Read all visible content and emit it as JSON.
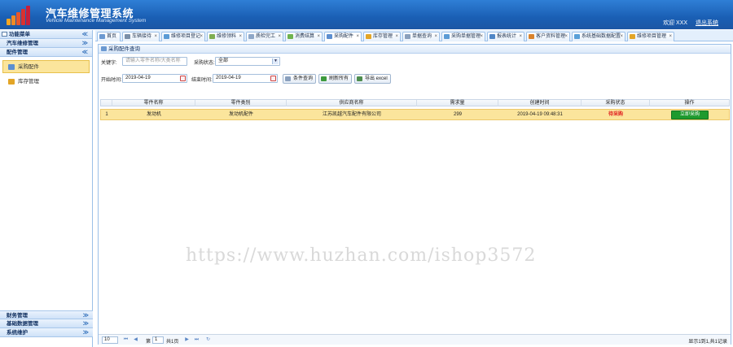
{
  "header": {
    "title": "汽车维修管理系统",
    "subtitle": "Vehicle Maintenance Management System",
    "welcome": "欢迎 XXX",
    "logout": "退出系统"
  },
  "sidebar": {
    "title": "功能菜单",
    "groups": [
      {
        "label": "汽车维修管理",
        "arrow": "≫"
      },
      {
        "label": "配件管理",
        "arrow": "≪"
      }
    ],
    "items": [
      {
        "label": "采购配件"
      },
      {
        "label": "库存管理"
      }
    ],
    "bottom_groups": [
      {
        "label": "财务管理",
        "arrow": "≫"
      },
      {
        "label": "基础数据管理",
        "arrow": "≫"
      },
      {
        "label": "系统维护",
        "arrow": "≫"
      }
    ],
    "collapse": "≪"
  },
  "tabs": [
    {
      "label": "首页"
    },
    {
      "label": "车辆接待"
    },
    {
      "label": "维修项目登记"
    },
    {
      "label": "维修领料"
    },
    {
      "label": "质检完工"
    },
    {
      "label": "消费结算"
    },
    {
      "label": "采购配件"
    },
    {
      "label": "库存管理"
    },
    {
      "label": "单据查询"
    },
    {
      "label": "采购单据管理"
    },
    {
      "label": "报表统计"
    },
    {
      "label": "客户资料管理"
    },
    {
      "label": "系统基础数据配置"
    },
    {
      "label": "维修项目管理"
    }
  ],
  "tab_close": "×",
  "panel": {
    "title": "采购配件查询"
  },
  "filters": {
    "keyword_label": "关键字:",
    "keyword_placeholder": "请输入零件名称/大类名称",
    "status_label": "采购状态:",
    "status_value": "全部",
    "start_label": "开始时间:",
    "start_value": "2019-04-19",
    "end_label": "结束时间:",
    "end_value": "2019-04-19",
    "search_btn": "条件查询",
    "refresh_btn": "刷新所有",
    "export_btn": "导出 excel"
  },
  "grid": {
    "columns": [
      "零件名称",
      "零件类别",
      "供应商名称",
      "需求量",
      "创建时间",
      "采购状态",
      "操作"
    ],
    "rows": [
      {
        "index": "1",
        "name": "发动机",
        "category": "发动机配件",
        "supplier": "江苏凯越汽车配件有限公司",
        "quantity": "299",
        "created": "2019-04-19 09:48:31",
        "status": "待采购",
        "action": "立即采购"
      }
    ]
  },
  "pager": {
    "page_size": "10",
    "page_label_pre": "第",
    "page_value": "1",
    "page_label_post": "共1页",
    "summary": "显示1到1,共1记录",
    "first": "⏮",
    "prev": "◀",
    "next": "▶",
    "last": "⏭",
    "refresh": "↻"
  },
  "watermark": "https://www.huzhan.com/ishop3572",
  "colors": {
    "header_blue": "#1a5fb4",
    "active_highlight": "#fbe59c",
    "buy_button": "#1e9a2e",
    "status_red": "#e02020"
  }
}
